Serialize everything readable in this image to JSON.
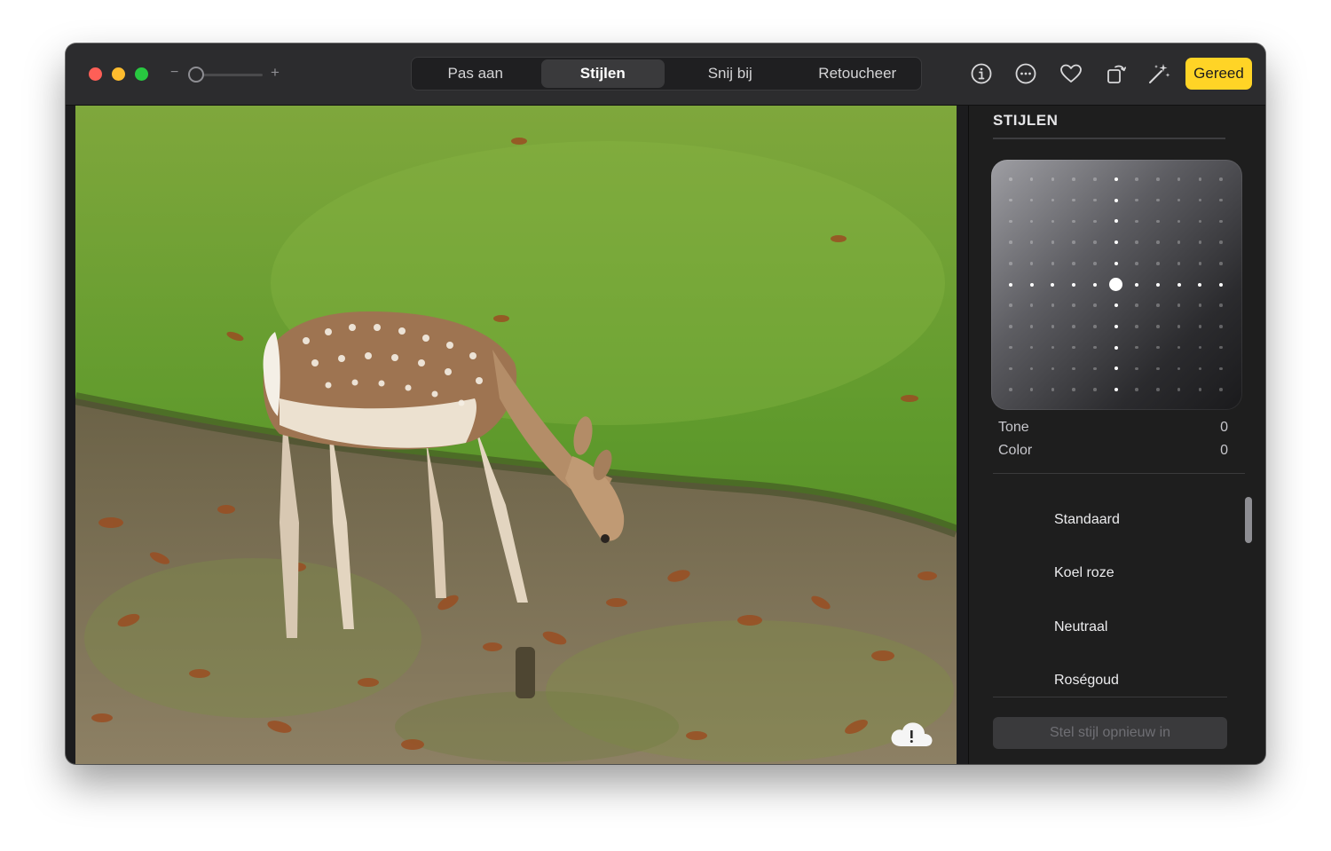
{
  "window_controls": {
    "zoom_minus": "−",
    "zoom_plus": "+"
  },
  "tabs": [
    {
      "label": "Pas aan",
      "active": false
    },
    {
      "label": "Stijlen",
      "active": true
    },
    {
      "label": "Snij bij",
      "active": false
    },
    {
      "label": "Retoucheer",
      "active": false
    }
  ],
  "toolbar": {
    "icons": [
      "info-icon",
      "more-icon",
      "heart-icon",
      "rotate-icon",
      "auto-enhance-icon"
    ],
    "done_label": "Gereed"
  },
  "sidebar": {
    "title": "STIJLEN",
    "tone": {
      "label": "Tone",
      "value": "0"
    },
    "color": {
      "label": "Color",
      "value": "0"
    },
    "styles": [
      "Standaard",
      "Koel roze",
      "Neutraal",
      "Roségoud"
    ],
    "reset_label": "Stel stijl opnieuw in"
  },
  "colors": {
    "accent": "#ffd426",
    "window_bg": "#1c1c1e",
    "titlebar_bg": "#2c2c2e",
    "sidebar_bg": "#1e1e1e"
  }
}
